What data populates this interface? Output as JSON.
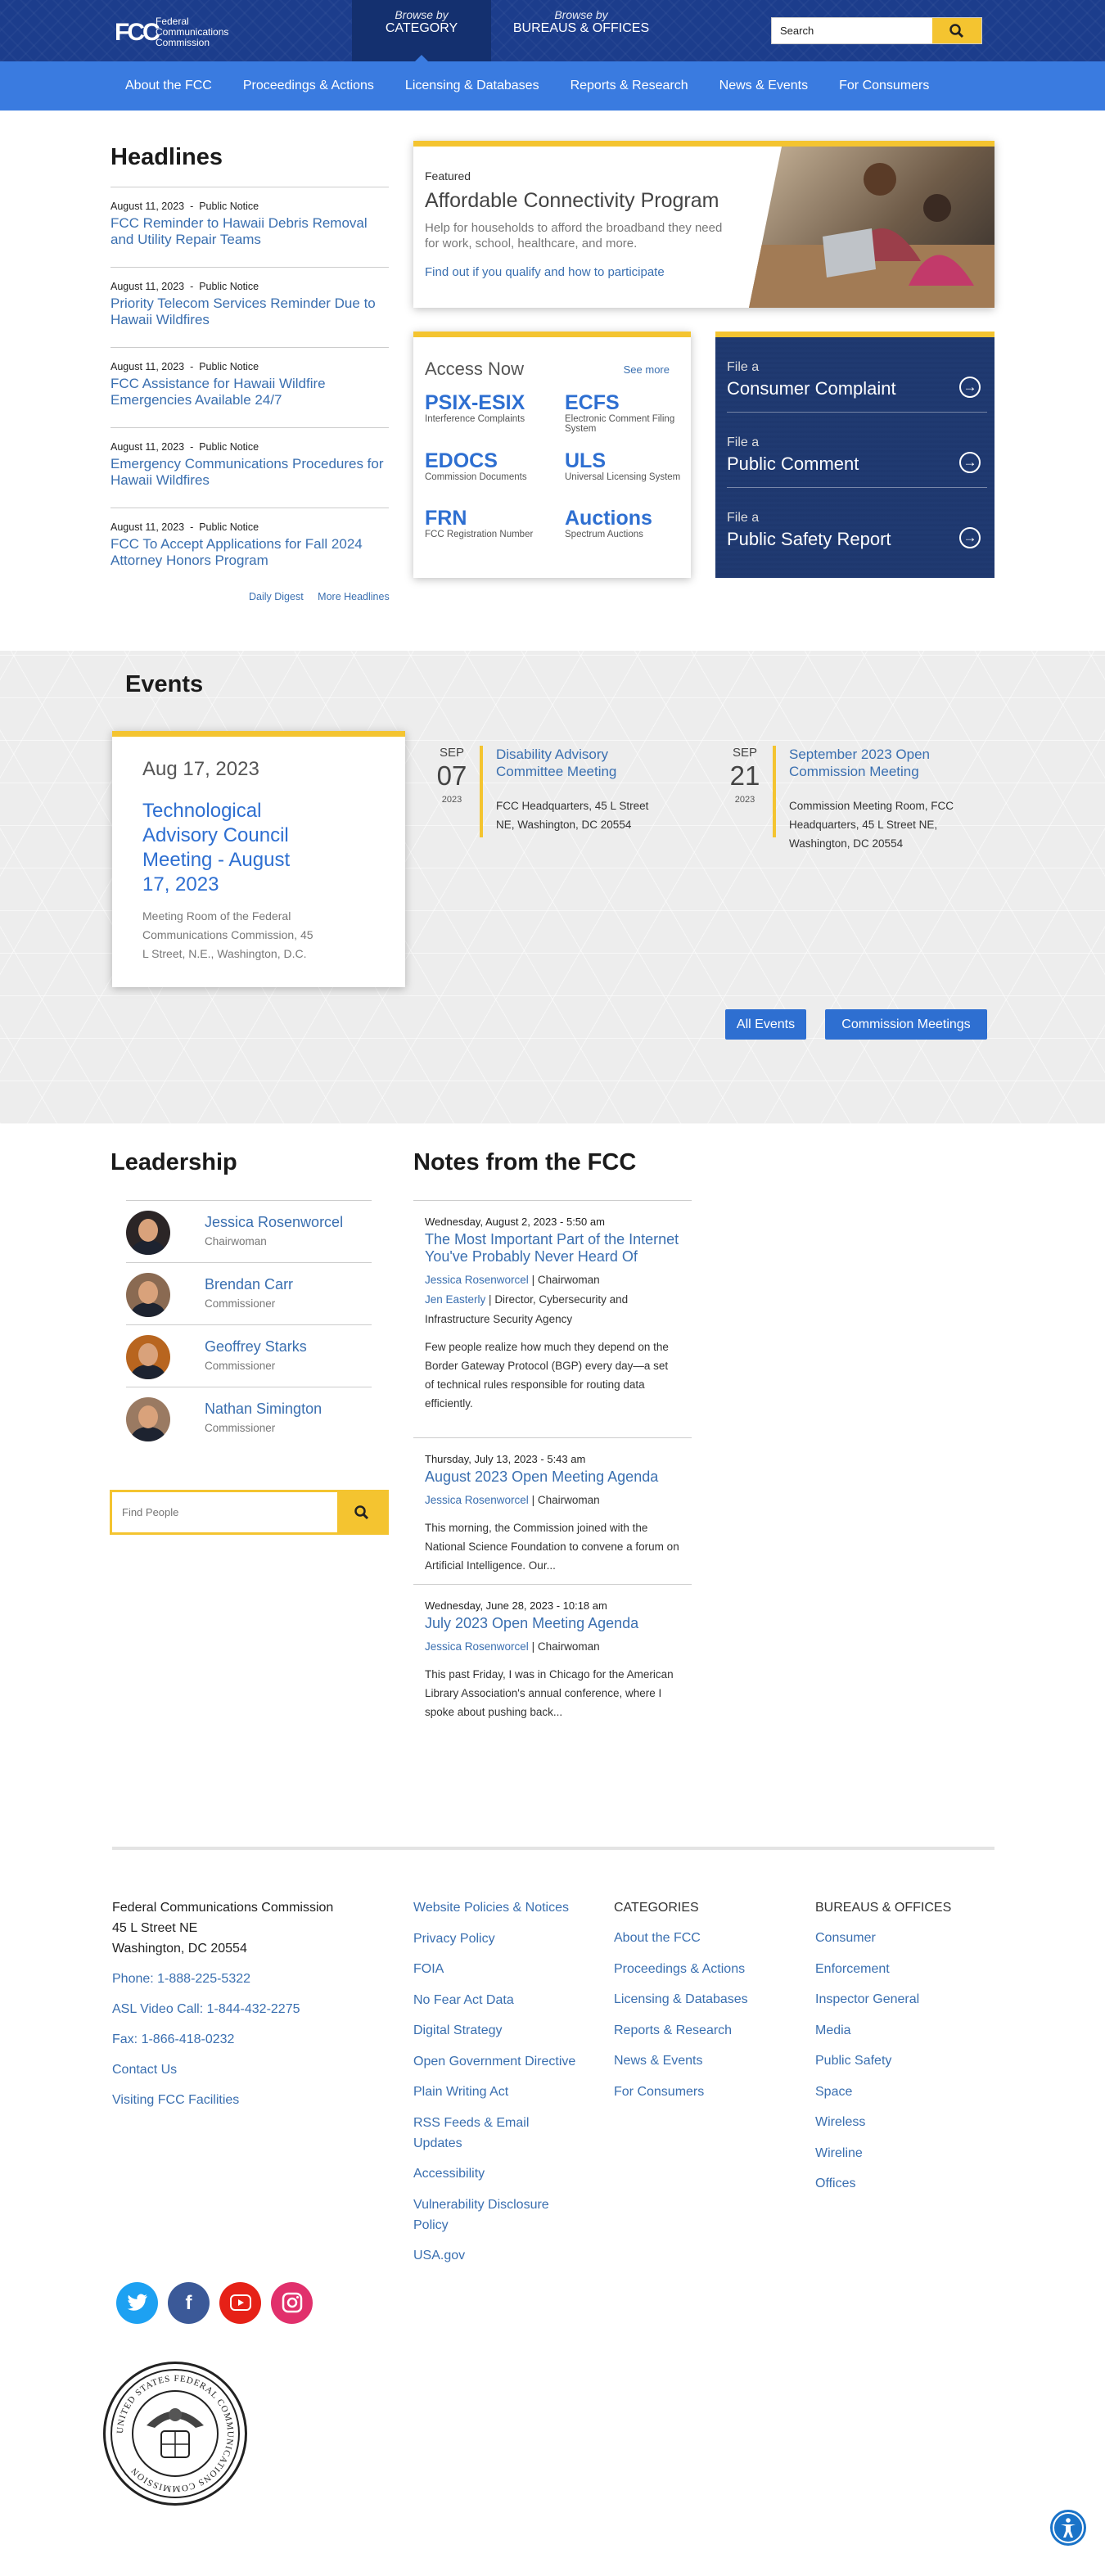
{
  "header": {
    "logo_mark": "FCC",
    "logo_text": [
      "Federal",
      "Communications",
      "Commission"
    ],
    "browse_category_italic": "Browse by",
    "browse_category": "CATEGORY",
    "browse_bureaus_italic": "Browse by",
    "browse_bureaus": "BUREAUS & OFFICES",
    "search_placeholder": "Search",
    "search_icon": "search-icon"
  },
  "nav": [
    "About the FCC",
    "Proceedings & Actions",
    "Licensing & Databases",
    "Reports & Research",
    "News & Events",
    "For Consumers"
  ],
  "headlines": {
    "title": "Headlines",
    "items": [
      {
        "date": "August 11, 2023",
        "type": "Public Notice",
        "title": "FCC Reminder to Hawaii Debris Removal and Utility Repair Teams"
      },
      {
        "date": "August 11, 2023",
        "type": "Public Notice",
        "title": "Priority Telecom Services Reminder Due to Hawaii Wildfires"
      },
      {
        "date": "August 11, 2023",
        "type": "Public Notice",
        "title": "FCC Assistance for Hawaii Wildfire Emergencies Available 24/7"
      },
      {
        "date": "August 11, 2023",
        "type": "Public Notice",
        "title": "Emergency Communications Procedures for Hawaii Wildfires"
      },
      {
        "date": "August 11, 2023",
        "type": "Public Notice",
        "title": "FCC To Accept Applications for Fall 2024 Attorney Honors Program"
      }
    ],
    "links": [
      "Daily Digest",
      "More Headlines"
    ]
  },
  "featured": {
    "label": "Featured",
    "title": "Affordable Connectivity Program",
    "description": "Help for households to afford the broadband they need for work, school, healthcare, and more.",
    "link": "Find out if you qualify and how to participate"
  },
  "access": {
    "title": "Access Now",
    "see_more": "See more",
    "items": [
      {
        "code": "PSIX-ESIX",
        "desc": "Interference Complaints"
      },
      {
        "code": "ECFS",
        "desc": "Electronic Comment Filing System"
      },
      {
        "code": "EDOCS",
        "desc": "Commission Documents"
      },
      {
        "code": "ULS",
        "desc": "Universal Licensing System"
      },
      {
        "code": "FRN",
        "desc": "FCC Registration Number"
      },
      {
        "code": "Auctions",
        "desc": "Spectrum Auctions"
      }
    ]
  },
  "file": [
    {
      "small": "File a",
      "big": "Consumer Complaint"
    },
    {
      "small": "File a",
      "big": "Public Comment"
    },
    {
      "small": "File a",
      "big": "Public Safety Report"
    }
  ],
  "events": {
    "title": "Events",
    "featured": {
      "date": "Aug 17, 2023",
      "title": "Technological Advisory Council Meeting - August 17, 2023",
      "location": "Meeting Room of the Federal Communications Commission, 45 L Street, N.E., Washington, D.C."
    },
    "items": [
      {
        "month": "SEP",
        "day": "07",
        "year": "2023",
        "title": "Disability Advisory Committee Meeting",
        "location": "FCC Headquarters, 45 L Street NE, Washington, DC 20554"
      },
      {
        "month": "SEP",
        "day": "21",
        "year": "2023",
        "title": "September 2023 Open Commission Meeting",
        "location": "Commission Meeting Room, FCC Headquarters, 45 L Street NE, Washington, DC 20554"
      }
    ],
    "buttons": [
      "All Events",
      "Commission Meetings"
    ]
  },
  "leadership": {
    "title": "Leadership",
    "people": [
      {
        "name": "Jessica Rosenworcel",
        "role": "Chairwoman"
      },
      {
        "name": "Brendan Carr",
        "role": "Commissioner"
      },
      {
        "name": "Geoffrey Starks",
        "role": "Commissioner"
      },
      {
        "name": "Nathan Simington",
        "role": "Commissioner"
      }
    ],
    "find_placeholder": "Find People"
  },
  "notes": {
    "title": "Notes from the FCC",
    "items": [
      {
        "date": "Wednesday, August 2, 2023 - 5:50 am",
        "title": "The Most Important Part of the Internet You've Probably Never Heard Of",
        "author": "Jessica Rosenworcel",
        "author_role": "Chairwoman",
        "coauthor": "Jen Easterly",
        "coauthor_role": "Director, Cybersecurity and Infrastructure Security Agency",
        "body": "Few people realize how much they depend on the Border Gateway Protocol (BGP) every day—a set of technical rules responsible for routing data efficiently."
      },
      {
        "date": "Thursday, July 13, 2023 - 5:43 am",
        "title": "August 2023 Open Meeting Agenda",
        "author": "Jessica Rosenworcel",
        "author_role": "Chairwoman",
        "body": "This morning, the Commission joined with the National Science Foundation to convene a forum on Artificial Intelligence. Our..."
      },
      {
        "date": "Wednesday, June 28, 2023 - 10:18 am",
        "title": "July 2023 Open Meeting Agenda",
        "author": "Jessica Rosenworcel",
        "author_role": "Chairwoman",
        "body": "This past Friday, I was in Chicago for the American Library Association's annual conference, where I spoke about pushing back..."
      }
    ]
  },
  "footer": {
    "address": [
      "Federal Communications Commission",
      "45 L Street NE",
      "Washington, DC 20554"
    ],
    "contact_links": [
      "Phone: 1-888-225-5322",
      "ASL Video Call: 1-844-432-2275",
      "Fax: 1-866-418-0232",
      "Contact Us",
      "Visiting FCC Facilities"
    ],
    "policy_links": [
      "Website Policies & Notices",
      "Privacy Policy",
      "FOIA",
      "No Fear Act Data",
      "Digital Strategy",
      "Open Government Directive",
      "Plain Writing Act",
      "RSS Feeds & Email Updates",
      "Accessibility",
      "Vulnerability Disclosure Policy",
      "USA.gov"
    ],
    "categories_title": "CATEGORIES",
    "categories": [
      "About the FCC",
      "Proceedings & Actions",
      "Licensing & Databases",
      "Reports & Research",
      "News & Events",
      "For Consumers"
    ],
    "bureaus_title": "BUREAUS & OFFICES",
    "bureaus": [
      "Consumer",
      "Enforcement",
      "Inspector General",
      "Media",
      "Public Safety",
      "Space",
      "Wireless",
      "Wireline",
      "Offices"
    ],
    "social": [
      {
        "icon": "twitter-icon",
        "color": "#1da1f2"
      },
      {
        "icon": "facebook-icon",
        "color": "#3b5998"
      },
      {
        "icon": "youtube-icon",
        "color": "#e62117"
      },
      {
        "icon": "instagram-icon",
        "color": "#e1306c"
      }
    ],
    "seal_text": "UNITED STATES FEDERAL COMMUNICATIONS COMMISSION"
  },
  "colors": {
    "navy": "#1c3d8c",
    "blue": "#3a7be0",
    "gold": "#f4c430",
    "link": "#3a6fb0"
  }
}
